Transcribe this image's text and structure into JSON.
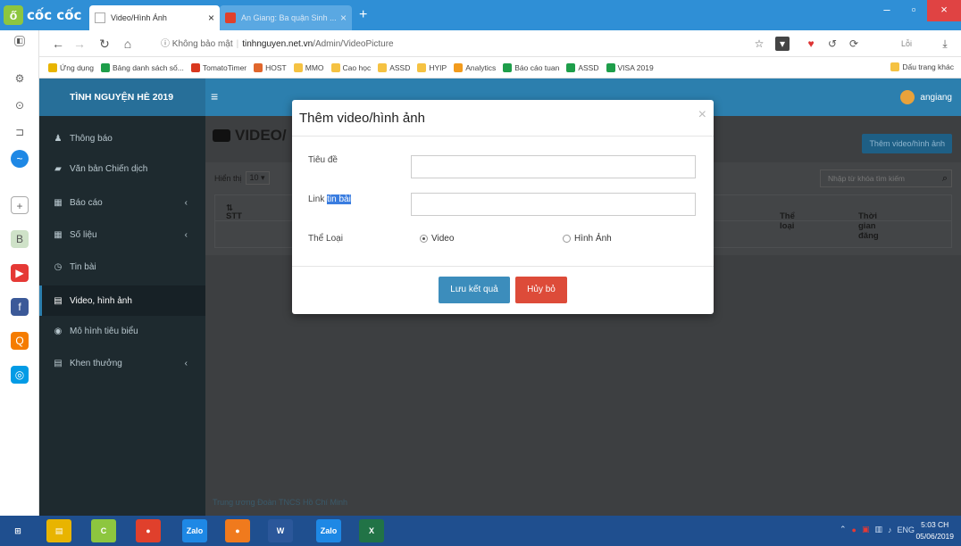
{
  "browser": {
    "brand": "cốc cốc",
    "tabs": [
      {
        "title": "Video/Hình Ảnh",
        "close": "×"
      },
      {
        "title": "An Giang: Ba quận Sinh ...",
        "close": "×"
      }
    ],
    "new_tab": "+",
    "window_controls": {
      "minimize": "–",
      "maximize": "▫",
      "close": "×"
    },
    "address": {
      "security": "Không bảo mật",
      "host": "tinhnguyen.net.vn",
      "path": "/Admin/VideoPicture"
    },
    "bookmarks": [
      {
        "label": "Ứng dụng",
        "color": "#e8b400"
      },
      {
        "label": "Bảng danh sách số...",
        "color": "#1e9e4a"
      },
      {
        "label": "TomatoTimer",
        "color": "#d9381e"
      },
      {
        "label": "HOST",
        "color": "#e0662c"
      },
      {
        "label": "MMO",
        "color": "#f5c242"
      },
      {
        "label": "Cao học",
        "color": "#f5c242"
      },
      {
        "label": "ASSD",
        "color": "#f5c242"
      },
      {
        "label": "HYIP",
        "color": "#f5c242"
      },
      {
        "label": "Analytics",
        "color": "#f29b1d"
      },
      {
        "label": "Báo cáo tuan",
        "color": "#1e9e4a"
      },
      {
        "label": "ASSD",
        "color": "#1e9e4a"
      },
      {
        "label": "VISA 2019",
        "color": "#1e9e4a"
      }
    ],
    "other_bookmarks": "Dấu trang khác",
    "profile_label": "Lỗi"
  },
  "app": {
    "title": "TÌNH NGUYỆN HÈ 2019",
    "menu_icon": "≡",
    "user": "angiang"
  },
  "sidenav": [
    {
      "label": "Thông báo",
      "icon": "bell-icon",
      "glyph": "♟",
      "chevron": ""
    },
    {
      "label": "Văn bản Chiến dịch",
      "icon": "car-icon",
      "glyph": "▰",
      "chevron": ""
    },
    {
      "label": "Báo cáo",
      "icon": "table-icon",
      "glyph": "▦",
      "chevron": "‹"
    },
    {
      "label": "Số liệu",
      "icon": "table-icon",
      "glyph": "▦",
      "chevron": "‹"
    },
    {
      "label": "Tin bài",
      "icon": "clock-icon",
      "glyph": "◷",
      "chevron": ""
    },
    {
      "label": "Video, hình ảnh",
      "icon": "file-icon",
      "glyph": "▤",
      "chevron": "",
      "active": true
    },
    {
      "label": "Mô hình tiêu biểu",
      "icon": "globe-icon",
      "glyph": "◉",
      "chevron": ""
    },
    {
      "label": "Khen thưởng",
      "icon": "list-icon",
      "glyph": "▤",
      "chevron": "‹"
    }
  ],
  "content": {
    "heading": "VIDEO/",
    "add_button": "Thêm video/hình ảnh",
    "show_label": "Hiển thị",
    "show_value": "10",
    "search_placeholder": "Nhập từ khóa tìm kiếm",
    "columns": {
      "stt": "STT",
      "category": "Thể loại",
      "date": "Thời gian đăng"
    },
    "footer": "Trung ương Đoàn TNCS Hồ Chí Minh"
  },
  "modal": {
    "title": "Thêm video/hình ảnh",
    "close": "×",
    "title_label": "Tiêu đề",
    "link_label_prefix": "Link",
    "link_label_highlight": "tin bài",
    "category_label": "Thể Loại",
    "options": [
      {
        "label": "Video",
        "checked": true
      },
      {
        "label": "Hình Ảnh",
        "checked": false
      }
    ],
    "save_button": "Lưu kết quả",
    "cancel_button": "Hủy bỏ"
  },
  "taskbar": {
    "apps": [
      {
        "name": "windows-start",
        "label": "⊞",
        "color": "#1f4f8f"
      },
      {
        "name": "file-explorer",
        "label": "▤",
        "color": "#e8b400"
      },
      {
        "name": "coccoc",
        "label": "C",
        "color": "#8dc63f"
      },
      {
        "name": "chrome",
        "label": "●",
        "color": "#e0402c"
      },
      {
        "name": "zalo",
        "label": "Zalo",
        "color": "#1e88e5"
      },
      {
        "name": "firefox",
        "label": "●",
        "color": "#f07a1d"
      },
      {
        "name": "word",
        "label": "W",
        "color": "#2b579a"
      },
      {
        "name": "zalo-2",
        "label": "Zalo",
        "color": "#1e88e5"
      },
      {
        "name": "excel",
        "label": "X",
        "color": "#217346"
      }
    ],
    "tray_lang": "ENG",
    "time": "5:03 CH",
    "date": "05/06/2019"
  }
}
